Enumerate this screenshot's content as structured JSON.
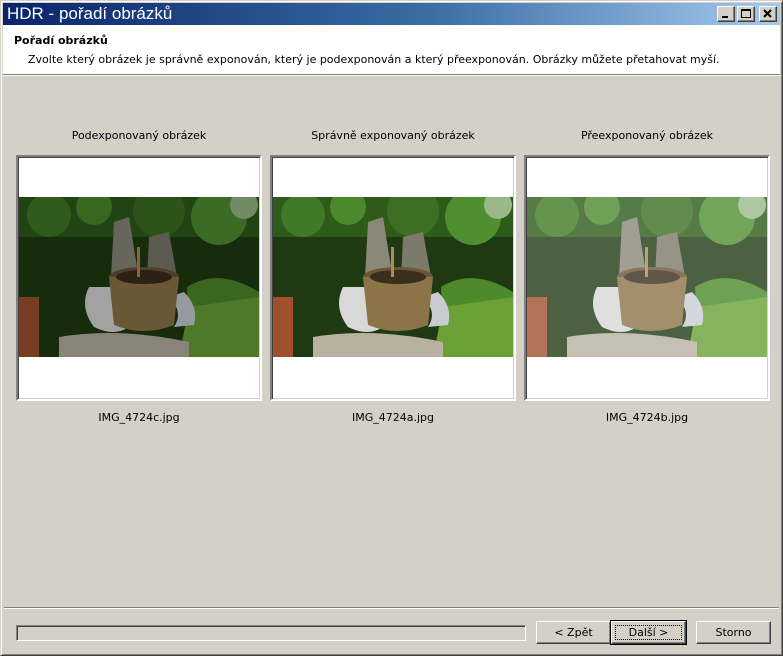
{
  "window": {
    "title": "HDR - pořadí obrázků"
  },
  "header": {
    "title": "Pořadí obrázků",
    "description": "Zvolte který obrázek je správně exponován, který je podexponován a který přeexponován. Obrázky můžete přetahovat myší."
  },
  "panels": [
    {
      "label": "Podexponovaný obrázek",
      "file": "IMG_4724c.jpg",
      "exposure": "under"
    },
    {
      "label": "Správně exponovaný obrázek",
      "file": "IMG_4724a.jpg",
      "exposure": "normal"
    },
    {
      "label": "Přeexponovaný obrázek",
      "file": "IMG_4724b.jpg",
      "exposure": "over"
    }
  ],
  "progress": {
    "value": 0
  },
  "buttons": {
    "back": "< Zpět",
    "next": "Další >",
    "cancel": "Storno"
  },
  "colors": {
    "titlebar_start": "#0a246a",
    "titlebar_end": "#a6caf0",
    "face": "#d4d0c8"
  }
}
